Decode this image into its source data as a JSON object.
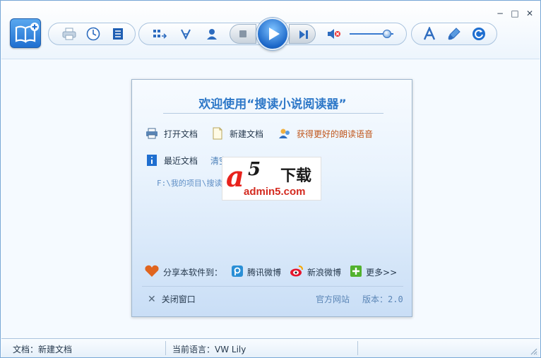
{
  "window": {
    "controls": {
      "minimize": "−",
      "maximize": "□",
      "close": "✕"
    }
  },
  "toolbar": {
    "app_icon": "book-plus-icon",
    "group1": [
      "print-icon",
      "clock-icon",
      "list-icon"
    ],
    "group2": [
      "arrange-icon",
      "voice-icon",
      "user-icon",
      "stop-icon",
      "play-icon",
      "next-icon",
      "mute-icon"
    ],
    "volume_percent": 80,
    "group3": [
      "font-icon",
      "brush-icon",
      "refresh-icon"
    ]
  },
  "dialog": {
    "title": "欢迎使用“搜读小说阅读器”",
    "open_doc": "打开文档",
    "new_doc": "新建文档",
    "get_voice": "获得更好的朗读语音",
    "recent_docs": "最近文档",
    "clear": "清空",
    "recent_path": "F:\\我的项目\\搜读",
    "recent_path_tail": "t",
    "ad": {
      "a": "a",
      "five": "5",
      "xiazai": "下载",
      "site": "admin5.com"
    },
    "share_label": "分享本软件到：",
    "tencent": "腾讯微博",
    "sina": "新浪微博",
    "more": "更多>>",
    "close": "关闭窗口",
    "official_site": "官方网站",
    "version": "版本：2.0"
  },
  "status": {
    "doc": "文档：新建文档",
    "language": "当前语言：VW Lily"
  },
  "colors": {
    "accent": "#2e78c8",
    "orange_link": "#c0561b",
    "ad_red": "#e8231d"
  }
}
